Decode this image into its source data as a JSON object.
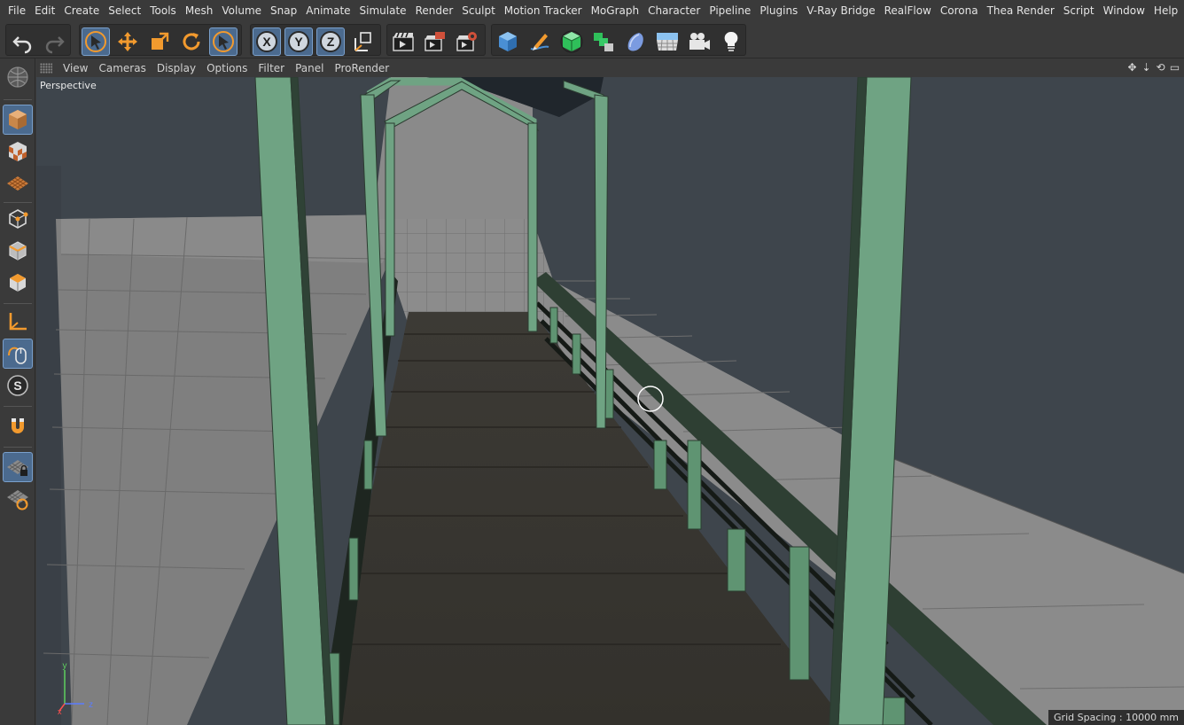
{
  "menu": [
    "File",
    "Edit",
    "Create",
    "Select",
    "Tools",
    "Mesh",
    "Volume",
    "Snap",
    "Animate",
    "Simulate",
    "Render",
    "Sculpt",
    "Motion Tracker",
    "MoGraph",
    "Character",
    "Pipeline",
    "Plugins",
    "V-Ray Bridge",
    "RealFlow",
    "Corona",
    "Thea Render",
    "Script",
    "Window",
    "Help"
  ],
  "toolbar": {
    "axis_x": "X",
    "axis_y": "Y",
    "axis_z": "Z"
  },
  "viewport_menu": {
    "items": [
      "View",
      "Cameras",
      "Display",
      "Options",
      "Filter",
      "Panel",
      "ProRender"
    ]
  },
  "viewport": {
    "label": "Perspective",
    "grid_spacing": "Grid Spacing : 10000 mm",
    "axis_labels": {
      "y": "y",
      "z": "z",
      "x": "x"
    }
  },
  "colors": {
    "accent_selected": "#4b6a8e",
    "frame_green": "#6fa383",
    "background_viewport": "#3f464d"
  },
  "icons": {
    "undo": "undo-icon",
    "redo": "redo-icon",
    "live_selection": "live-selection-icon",
    "move": "move-icon",
    "scale": "scale-icon",
    "rotate": "rotate-icon",
    "last_tool": "last-tool-icon",
    "coord_system": "world-coordinates-icon",
    "render_view": "render-view-icon",
    "render_pv": "render-picture-viewer-icon",
    "render_settings": "render-settings-icon",
    "cube": "cube-icon",
    "pen": "pen-icon",
    "subdivision": "subdivision-icon",
    "array": "array-icon",
    "deformer": "deformer-icon",
    "floor": "floor-icon",
    "camera": "camera-icon",
    "light": "light-icon"
  }
}
